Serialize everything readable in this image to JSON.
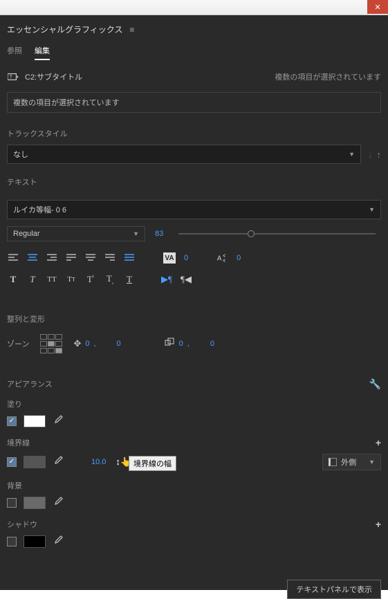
{
  "panel": {
    "title": "エッセンシャルグラフィックス"
  },
  "tabs": {
    "browse": "参照",
    "edit": "編集"
  },
  "source": {
    "name": "C2:サブタイトル",
    "status": "複数の項目が選択されています"
  },
  "warning": "複数の項目が選択されています",
  "trackstyle": {
    "label": "トラックスタイル",
    "value": "なし"
  },
  "text": {
    "label": "テキスト",
    "font": "ルイカ等幅- 0 6",
    "style": "Regular",
    "size": "83",
    "kerning": "0",
    "tracking": "0"
  },
  "align": {
    "label": "整列と変形",
    "zone": "ゾーン",
    "x": "0",
    "xf": ",",
    "y": "0",
    "sx": "0",
    "sxf": ",",
    "sy": "0"
  },
  "appearance": {
    "label": "アピアランス",
    "fill": {
      "label": "塗り",
      "color": "#ffffff"
    },
    "stroke": {
      "label": "境界線",
      "color": "#555555",
      "width": "10.0",
      "pos": "外側",
      "tooltip": "境界線の幅"
    },
    "bg": {
      "label": "背景",
      "color": "#6a6a6a"
    },
    "shadow": {
      "label": "シャドウ",
      "color": "#000000"
    }
  },
  "footer": {
    "button": "テキストパネルで表示"
  }
}
